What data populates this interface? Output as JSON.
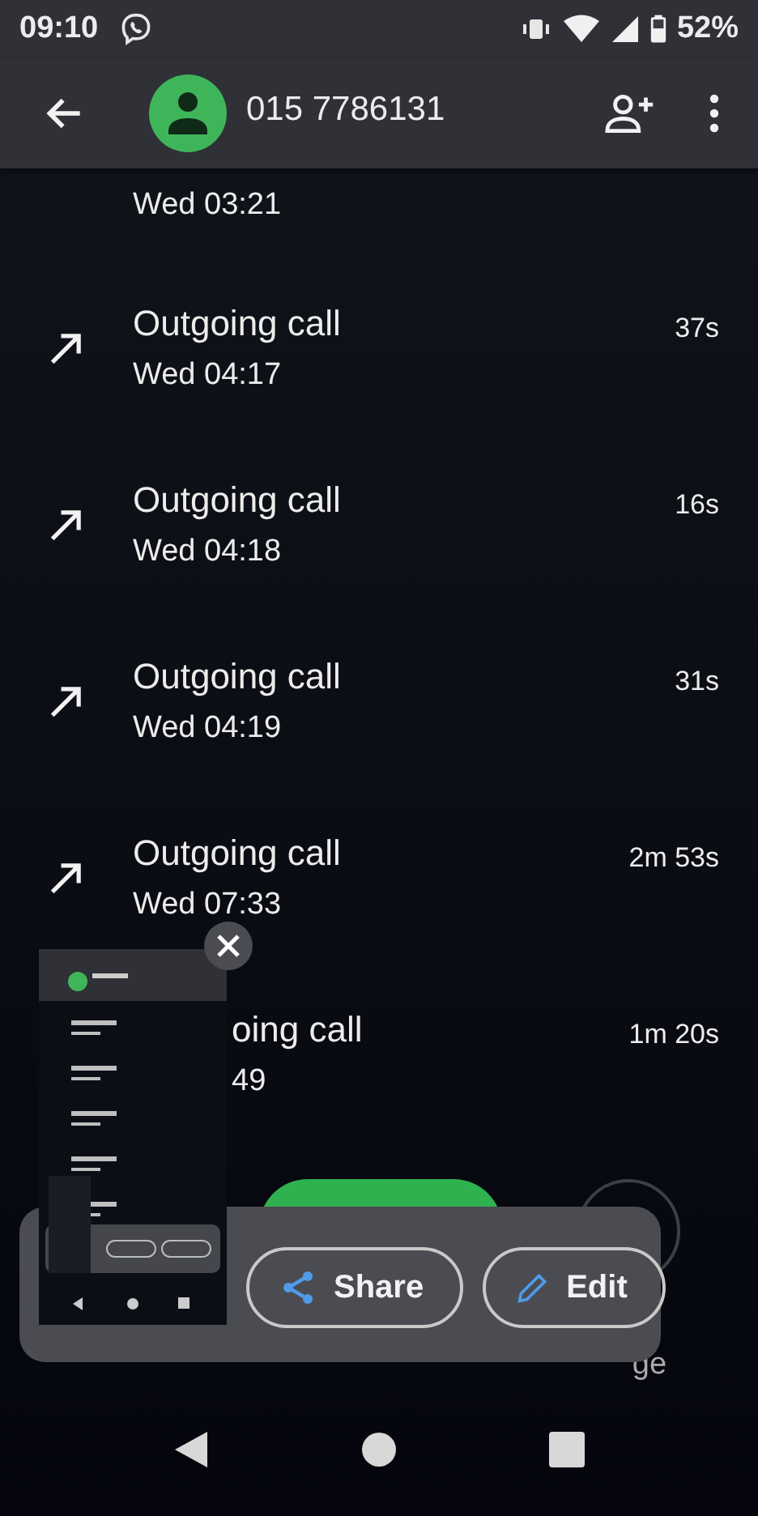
{
  "status_bar": {
    "time": "09:10",
    "battery": "52%"
  },
  "header": {
    "title": "015 7786131"
  },
  "partial_row": {
    "time": "Wed 03:21"
  },
  "calls": [
    {
      "title": "Outgoing call",
      "time": "Wed 04:17",
      "duration": "37s",
      "covered": false
    },
    {
      "title": "Outgoing call",
      "time": "Wed 04:18",
      "duration": "16s",
      "covered": false
    },
    {
      "title": "Outgoing call",
      "time": "Wed 04:19",
      "duration": "31s",
      "covered": false
    },
    {
      "title": "Outgoing call",
      "time": "Wed 07:33",
      "duration": "2m 53s",
      "covered": false
    },
    {
      "title": "oing call",
      "time": "49",
      "duration": "1m 20s",
      "covered": true
    }
  ],
  "footer": {
    "action_label": "ge"
  },
  "screenshot_preview": {
    "buttons": [
      {
        "kind": "share",
        "label": "Share"
      },
      {
        "kind": "edit",
        "label": "Edit"
      }
    ]
  }
}
